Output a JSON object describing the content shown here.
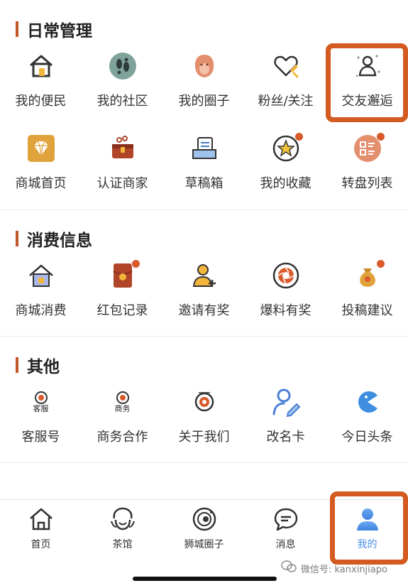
{
  "sections": [
    {
      "title": "日常管理"
    },
    {
      "title": "消费信息"
    },
    {
      "title": "其他"
    }
  ],
  "daily": [
    {
      "label": "我的便民",
      "icon": "house-icon"
    },
    {
      "label": "我的社区",
      "icon": "footprints-icon"
    },
    {
      "label": "我的圈子",
      "icon": "lion-icon"
    },
    {
      "label": "粉丝/关注",
      "icon": "heart-pen-icon"
    },
    {
      "label": "交友邂逅",
      "icon": "person-sparkle-icon"
    },
    {
      "label": "商城首页",
      "icon": "diamond-icon"
    },
    {
      "label": "认证商家",
      "icon": "treasure-chest-icon"
    },
    {
      "label": "草稿箱",
      "icon": "drafts-icon"
    },
    {
      "label": "我的收藏",
      "icon": "star-icon"
    },
    {
      "label": "转盘列表",
      "icon": "list-icon"
    }
  ],
  "consume": [
    {
      "label": "商城消费",
      "icon": "shop-house-icon"
    },
    {
      "label": "红包记录",
      "icon": "red-packet-icon"
    },
    {
      "label": "邀请有奖",
      "icon": "invite-icon"
    },
    {
      "label": "爆料有奖",
      "icon": "camera-shutter-icon"
    },
    {
      "label": "投稿建议",
      "icon": "money-bag-icon"
    }
  ],
  "other": [
    {
      "label": "客服号",
      "icon": "service-logo-icon",
      "icon_text": "客服"
    },
    {
      "label": "商务合作",
      "icon": "business-logo-icon",
      "icon_text": "商务"
    },
    {
      "label": "关于我们",
      "icon": "about-logo-icon"
    },
    {
      "label": "改名卡",
      "icon": "edit-user-icon"
    },
    {
      "label": "今日头条",
      "icon": "pacman-icon"
    }
  ],
  "tabs": [
    {
      "label": "首页",
      "icon": "home-icon"
    },
    {
      "label": "茶馆",
      "icon": "tea-lion-icon"
    },
    {
      "label": "狮城圈子",
      "icon": "orbit-icon"
    },
    {
      "label": "消息",
      "icon": "chat-icon"
    },
    {
      "label": "我的",
      "icon": "user-icon",
      "active": true
    }
  ],
  "watermark": "微信号: kanxinjiapo",
  "colors": {
    "accent": "#d35a20",
    "active_tab": "#4a90e2",
    "badge": "#d95a2b"
  }
}
